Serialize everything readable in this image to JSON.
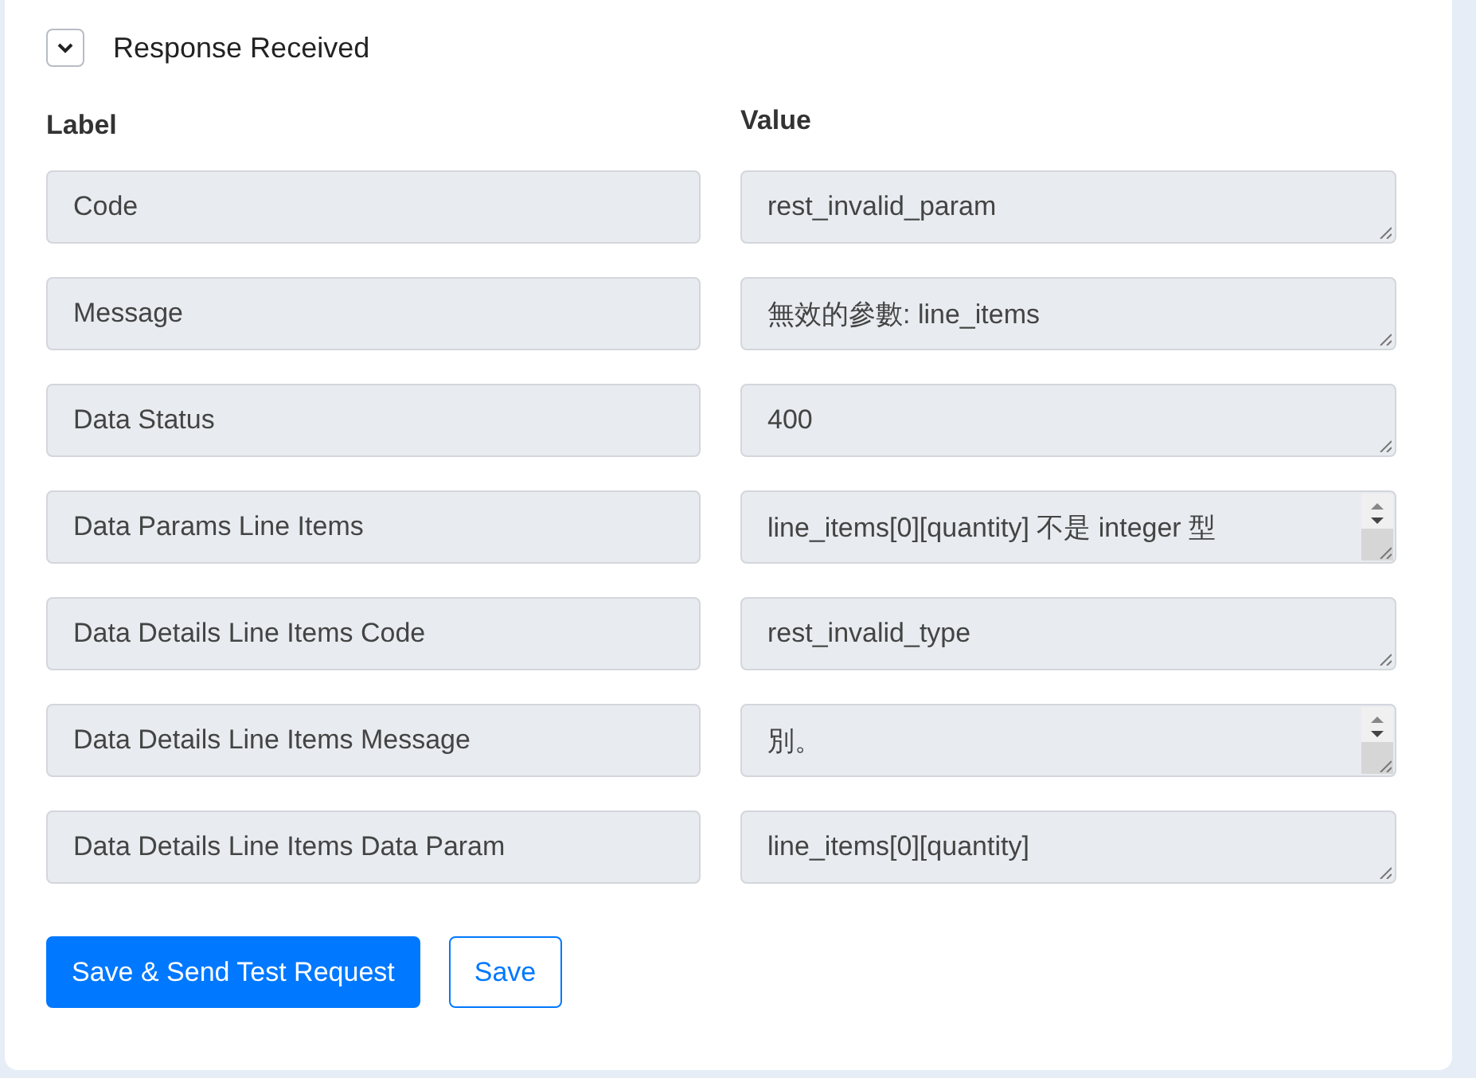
{
  "section": {
    "title": "Response Received",
    "expanded": true
  },
  "columns": {
    "label": "Label",
    "value": "Value"
  },
  "rows": [
    {
      "label": "Code",
      "value": "rest_invalid_param",
      "scrollable": false
    },
    {
      "label": "Message",
      "value": "無效的參數: line_items",
      "scrollable": false
    },
    {
      "label": "Data Status",
      "value": "400",
      "scrollable": false
    },
    {
      "label": "Data Params Line Items",
      "value": "line_items[0][quantity] 不是 integer 型",
      "scrollable": true
    },
    {
      "label": "Data Details Line Items Code",
      "value": "rest_invalid_type",
      "scrollable": false
    },
    {
      "label": "Data Details Line Items Message",
      "value": "別。",
      "scrollable": true
    },
    {
      "label": "Data Details Line Items Data Param",
      "value": "line_items[0][quantity]",
      "scrollable": false
    }
  ],
  "buttons": [
    {
      "label": "Save & Send Test Request",
      "kind": "primary"
    },
    {
      "label": "Save",
      "kind": "outline"
    }
  ]
}
